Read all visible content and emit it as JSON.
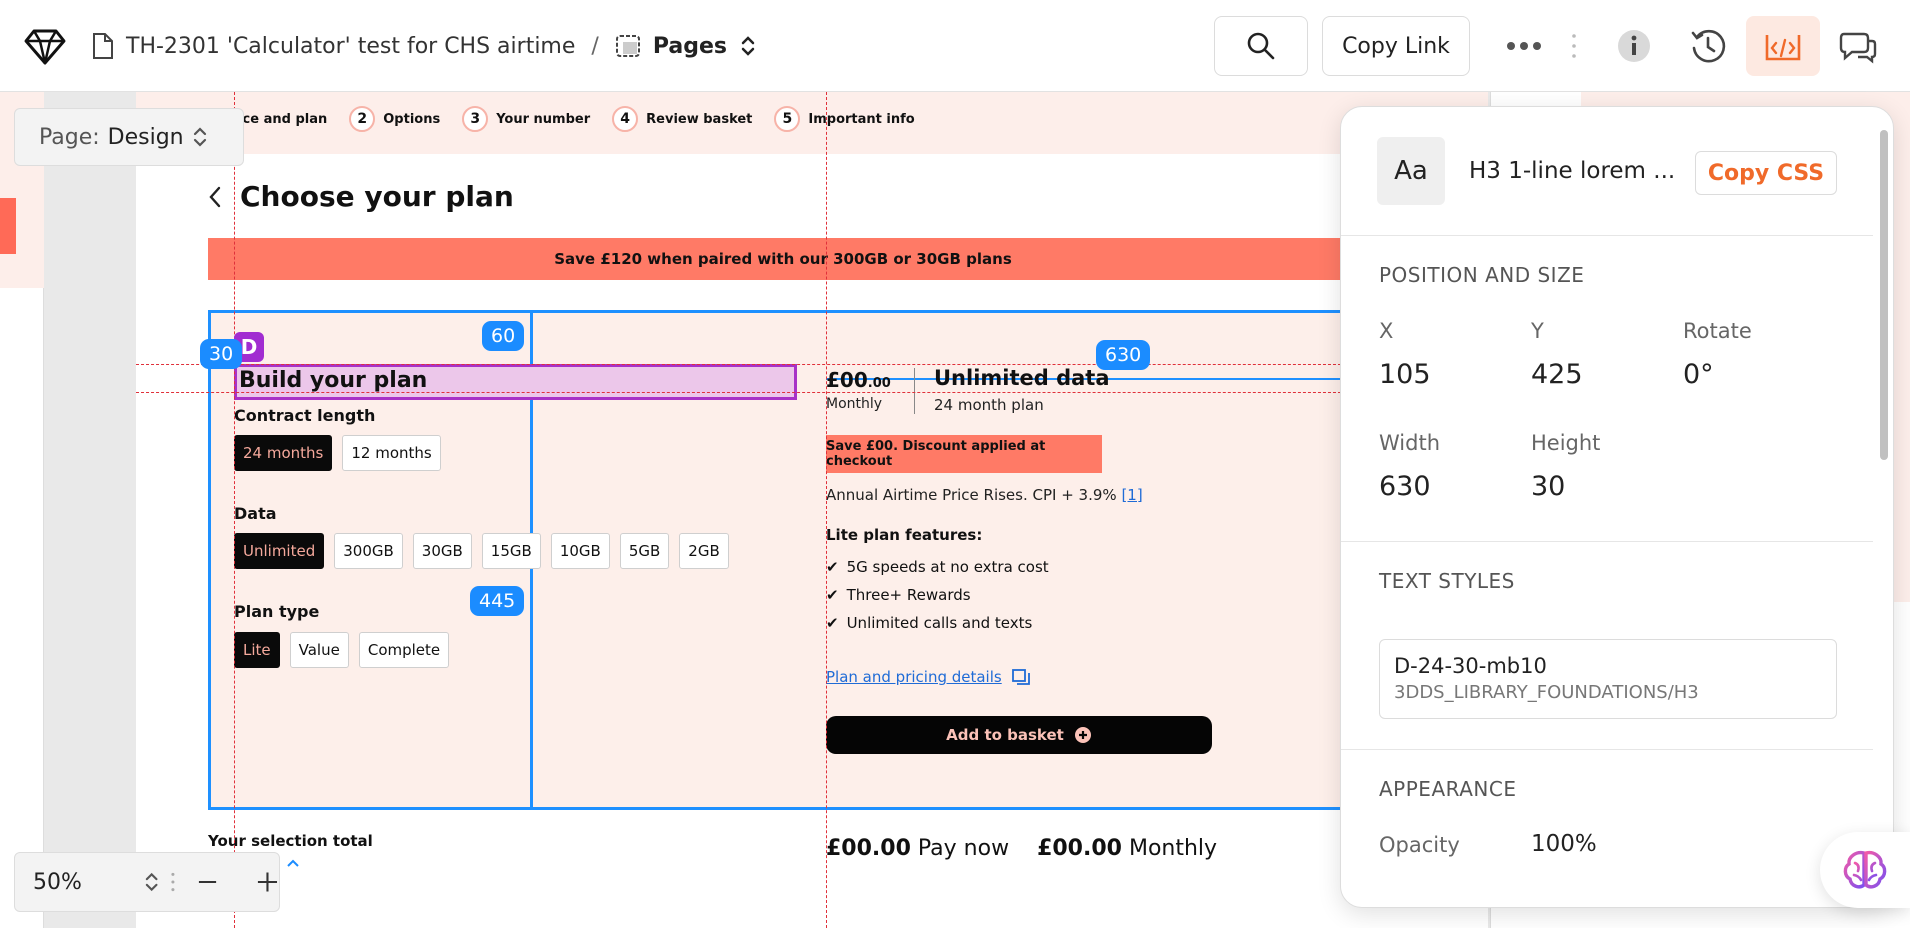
{
  "topbar": {
    "file_title": "TH-2301 'Calculator' test for CHS airtime",
    "separator": "/",
    "pages_label": "Pages",
    "copy_link": "Copy Link"
  },
  "canvas": {
    "page_select": {
      "prefix": "Page:",
      "value": "Design"
    },
    "zoom": {
      "value": "50%"
    }
  },
  "design": {
    "steps": [
      {
        "label": "Device and plan"
      },
      {
        "num": "2",
        "label": "Options"
      },
      {
        "num": "3",
        "label": "Your number"
      },
      {
        "num": "4",
        "label": "Review basket"
      },
      {
        "num": "5",
        "label": "Important info"
      }
    ],
    "title": "Choose your plan",
    "banner": "Save £120 when paired with our 300GB or 30GB plans",
    "build_title": "Build your plan",
    "contract_label": "Contract length",
    "contract_options": [
      "24 months",
      "12 months"
    ],
    "data_label": "Data",
    "data_options": [
      "Unlimited",
      "300GB",
      "30GB",
      "15GB",
      "10GB",
      "5GB",
      "2GB"
    ],
    "plan_type_label": "Plan type",
    "plan_type_options": [
      "Lite",
      "Value",
      "Complete"
    ],
    "price_main": "£00",
    "price_decimal": ".00",
    "price_period": "Monthly",
    "plan_name": "Unlimited data",
    "plan_term": "24 month plan",
    "discount": "Save £00. Discount applied at checkout",
    "cpi_text": "Annual Airtime Price Rises. CPI + 3.9%",
    "cpi_link": "[1]",
    "features_title": "Lite plan features:",
    "features": [
      "5G speeds at no extra cost",
      "Three+ Rewards",
      "Unlimited calls and texts"
    ],
    "details_link": "Plan and pricing details",
    "basket_button": "Add to basket",
    "total_label": "Your selection total",
    "pay_now_amount": "£00.00",
    "pay_now_label": "Pay now",
    "monthly_amount": "£00.00",
    "monthly_label": "Monthly"
  },
  "measurements": {
    "top_gap": "60",
    "left_gap": "30",
    "width_badge": "630",
    "bottom_gap": "445",
    "component_marker": "D"
  },
  "inspector": {
    "aa": "Aa",
    "name": "H3 1-line lorem ...",
    "copy_css": "Copy CSS",
    "position_section": "POSITION AND SIZE",
    "x_label": "X",
    "x_value": "105",
    "y_label": "Y",
    "y_value": "425",
    "rotate_label": "Rotate",
    "rotate_value": "0°",
    "width_label": "Width",
    "width_value": "630",
    "height_label": "Height",
    "height_value": "30",
    "text_styles_section": "TEXT STYLES",
    "style_name": "D-24-30-mb10",
    "style_path": "3DDS_LIBRARY_FOUNDATIONS/H3",
    "appearance_section": "APPEARANCE",
    "opacity_label": "Opacity",
    "opacity_value": "100%"
  },
  "colors": {
    "accent_orange": "#f06a2a",
    "banner_coral": "#ff7a66",
    "measure_blue": "#1b8cff",
    "selection_purple": "#a12cd1"
  }
}
